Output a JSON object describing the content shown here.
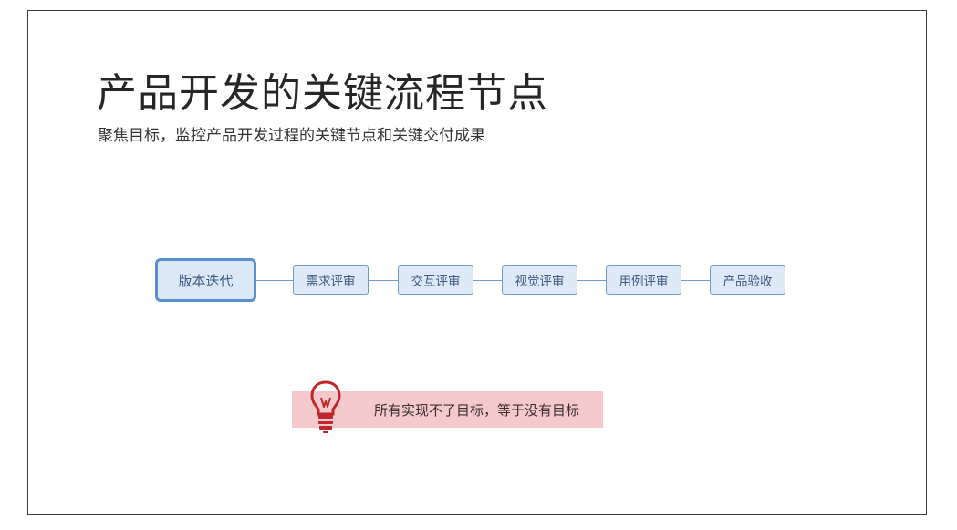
{
  "title": "产品开发的关键流程节点",
  "subtitle": "聚焦目标，监控产品开发过程的关键节点和关键交付成果",
  "flow": {
    "main_node": "版本迭代",
    "steps": [
      "需求评审",
      "交互评审",
      "视觉评审",
      "用例评审",
      "产品验收"
    ]
  },
  "callout": {
    "icon": "lightbulb-icon",
    "text": "所有实现不了目标，等于没有目标"
  },
  "colors": {
    "node_border": "#5b8dd0",
    "node_fill": "#dbe8f7",
    "callout_bg": "#f4c9cc",
    "bulb": "#c0262d"
  }
}
